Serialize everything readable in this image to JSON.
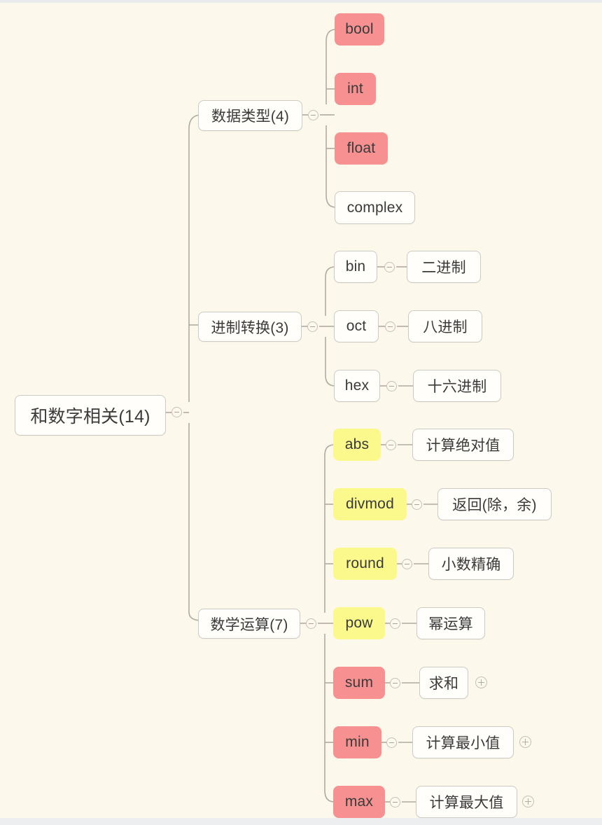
{
  "theme": {
    "background": "#fdf8ec",
    "node_white_bg": "#fffefb",
    "node_border": "#cdcac4",
    "node_pink_bg": "#f79191",
    "node_yellow_bg": "#fbf98c",
    "link_color": "#b0aaa2",
    "text_color": "#3a3a3a"
  },
  "mindmap": {
    "root": {
      "label": "和数字相关(14)",
      "style": "white",
      "toggle": "collapse-minus"
    },
    "branches": [
      {
        "label": "数据类型(4)",
        "style": "white",
        "toggle": "collapse-minus",
        "children": [
          {
            "label": "bool",
            "style": "pink",
            "toggle": null,
            "description": null
          },
          {
            "label": "int",
            "style": "pink",
            "toggle": null,
            "description": null
          },
          {
            "label": "float",
            "style": "pink",
            "toggle": null,
            "description": null
          },
          {
            "label": "complex",
            "style": "white",
            "toggle": null,
            "description": null
          }
        ]
      },
      {
        "label": "进制转换(3)",
        "style": "white",
        "toggle": "collapse-minus",
        "children": [
          {
            "label": "bin",
            "style": "white",
            "toggle": "collapse-minus",
            "description": "二进制"
          },
          {
            "label": "oct",
            "style": "white",
            "toggle": "collapse-minus",
            "description": "八进制"
          },
          {
            "label": "hex",
            "style": "white",
            "toggle": "collapse-minus",
            "description": "十六进制"
          }
        ]
      },
      {
        "label": "数学运算(7)",
        "style": "white",
        "toggle": "collapse-minus",
        "children": [
          {
            "label": "abs",
            "style": "yellow",
            "toggle": "collapse-minus",
            "description": "计算绝对值",
            "description_expand": false
          },
          {
            "label": "divmod",
            "style": "yellow",
            "toggle": "collapse-minus",
            "description": "返回(除，余)",
            "description_expand": false
          },
          {
            "label": "round",
            "style": "yellow",
            "toggle": "collapse-minus",
            "description": "小数精确",
            "description_expand": false
          },
          {
            "label": "pow",
            "style": "yellow",
            "toggle": "collapse-minus",
            "description": "幂运算",
            "description_expand": false
          },
          {
            "label": "sum",
            "style": "pink",
            "toggle": "collapse-minus",
            "description": "求和",
            "description_expand": true
          },
          {
            "label": "min",
            "style": "pink",
            "toggle": "collapse-minus",
            "description": "计算最小值",
            "description_expand": true
          },
          {
            "label": "max",
            "style": "pink",
            "toggle": "collapse-minus",
            "description": "计算最大值",
            "description_expand": true
          }
        ]
      }
    ]
  }
}
